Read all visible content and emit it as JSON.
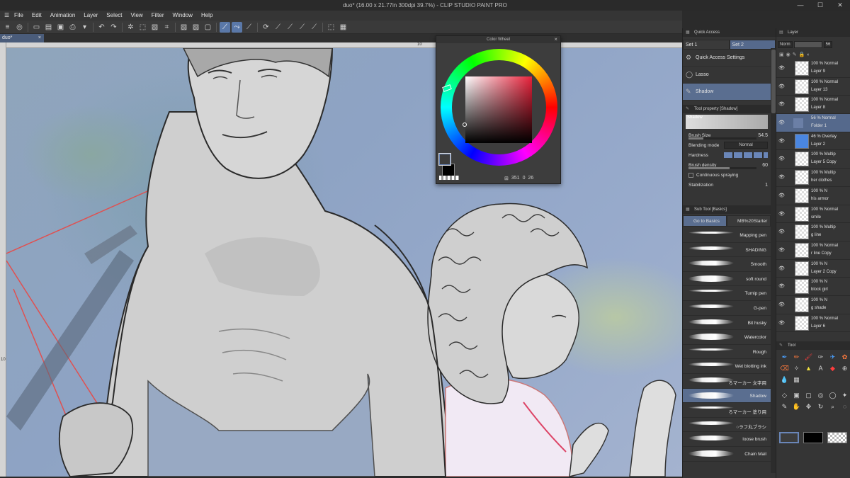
{
  "title_bar": {
    "title": "duo* (16.00 x 21.77in 300dpi 39.7%) - CLIP STUDIO PAINT PRO",
    "minimize": "—",
    "maximize": "☐",
    "close": "✕"
  },
  "menu": [
    "File",
    "Edit",
    "Animation",
    "Layer",
    "Select",
    "View",
    "Filter",
    "Window",
    "Help"
  ],
  "document_tab": {
    "label": "duo*",
    "close": "×"
  },
  "rulers": {
    "top_mark": "10",
    "left_mark": "10"
  },
  "color_wheel": {
    "title": "Color Wheel",
    "hue": "351",
    "saturation": "0",
    "value": "26",
    "main_color": "#3d3d3d",
    "sub_color": "#000000"
  },
  "quick_access": {
    "title": "Quick Access",
    "sets": [
      "Set 1",
      "Set 2"
    ],
    "items": [
      {
        "label": "Quick Access Settings",
        "icon": "gear-icon"
      },
      {
        "label": "Lasso",
        "icon": "lasso-icon"
      },
      {
        "label": "Shadow",
        "icon": "brush-icon"
      }
    ]
  },
  "tool_property": {
    "title": "Tool property [Shadow]",
    "preset_name": "Shadow",
    "brush_size_label": "Brush Size",
    "brush_size": "54.5",
    "blending_label": "Blending mode",
    "blending_value": "Normal",
    "hardness_label": "Hardness",
    "density_label": "Brush density",
    "density": "60",
    "continuous_label": "Continuous spraying",
    "stabilization_label": "Stabilization",
    "stabilization": "1"
  },
  "sub_tool": {
    "title": "Sub Tool [Basics]",
    "tabs": [
      "Go to Basics",
      "MB%20Starter"
    ],
    "brushes": [
      "Mapping pen",
      "SHADING",
      "Smooth",
      "soft round",
      "Tumip pen",
      "G-pen",
      "Bit husky",
      "Watercolor",
      "Rough",
      "Wet blotting ink",
      "ろマーカー 文字用",
      "Shadow",
      "ろマーカー 塗り用",
      "○ラフ丸ブラシ",
      "loose brush",
      "Chain Mail"
    ],
    "selected": "Shadow"
  },
  "layer_panel": {
    "title": "Layer",
    "blend_mode": "Norm",
    "opacity": "56",
    "layers": [
      {
        "blend": "100 % Normal",
        "name": "Layer 9"
      },
      {
        "blend": "100 % Normal",
        "name": "Layer 13"
      },
      {
        "blend": "100 % Normal",
        "name": "Layer 8"
      },
      {
        "blend": "56 % Normal",
        "name": "Folder 1"
      },
      {
        "blend": "46 % Overlay",
        "name": "Layer 2"
      },
      {
        "blend": "100 % Multip",
        "name": "Layer 5 Copy"
      },
      {
        "blend": "100 % Multip",
        "name": "her clothes"
      },
      {
        "blend": "100 % N",
        "name": "his armor"
      },
      {
        "blend": "100 % Normal",
        "name": "smile"
      },
      {
        "blend": "100 % Multip",
        "name": "g line"
      },
      {
        "blend": "100 % Normal",
        "name": "r line Copy"
      },
      {
        "blend": "100 % N",
        "name": "Layer 2 Copy"
      },
      {
        "blend": "100 % N",
        "name": "block girl"
      },
      {
        "blend": "100 % N",
        "name": "g shade"
      },
      {
        "blend": "100 % Normal",
        "name": "Layer 6"
      }
    ]
  },
  "tool_panel": {
    "title": "Tool"
  }
}
